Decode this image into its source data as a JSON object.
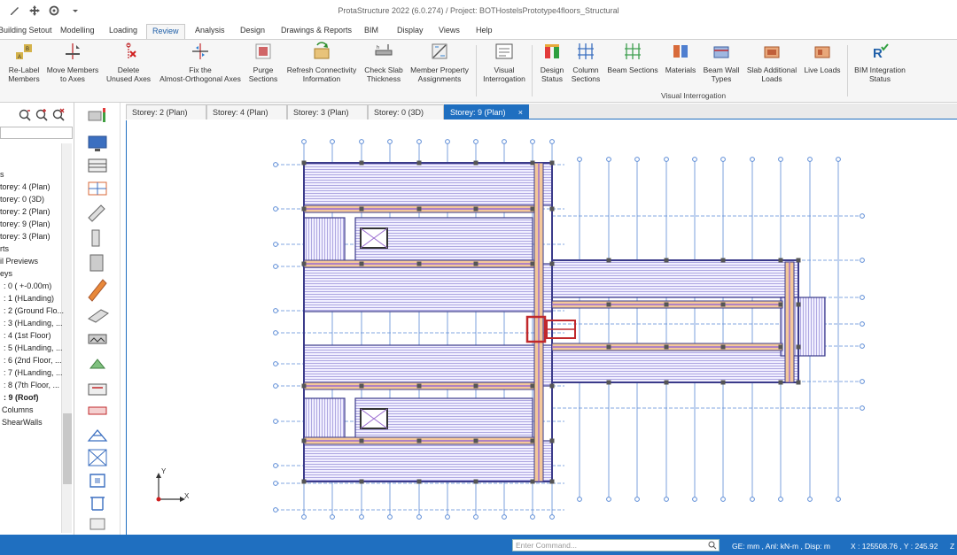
{
  "window": {
    "title": "ProtaStructure 2022 (6.0.274) / Project: BOTHostelsPrototype4floors_Structural"
  },
  "quick_access": [
    "edit-icon",
    "move-icon",
    "settings-icon",
    "dropdown-icon"
  ],
  "menu": {
    "tabs": [
      "Building Setout",
      "Modelling",
      "Loading",
      "Review",
      "Analysis",
      "Design",
      "Drawings & Reports",
      "BIM",
      "Display",
      "Views",
      "Help"
    ],
    "active": "Review"
  },
  "ribbon": {
    "buttons": [
      {
        "l1": "Re-Label",
        "l2": "Members"
      },
      {
        "l1": "Move Members",
        "l2": "to Axes"
      },
      {
        "l1": "Delete",
        "l2": "Unused Axes"
      },
      {
        "l1": "Fix the",
        "l2": "Almost-Orthogonal Axes"
      },
      {
        "l1": "Purge",
        "l2": "Sections"
      },
      {
        "l1": "Refresh Connectivity",
        "l2": "Information"
      },
      {
        "l1": "Check Slab",
        "l2": "Thickness"
      },
      {
        "l1": "Member Property",
        "l2": "Assignments"
      },
      {
        "l1": "Visual",
        "l2": "Interrogation"
      },
      {
        "l1": "Design",
        "l2": "Status"
      },
      {
        "l1": "Column",
        "l2": "Sections"
      },
      {
        "l1": "Beam Sections",
        "l2": ""
      },
      {
        "l1": "Materials",
        "l2": ""
      },
      {
        "l1": "Beam Wall",
        "l2": "Types"
      },
      {
        "l1": "Slab Additional",
        "l2": "Loads"
      },
      {
        "l1": "Live Loads",
        "l2": ""
      },
      {
        "l1": "BIM Integration",
        "l2": "Status"
      }
    ],
    "group_label": "Visual Interrogation"
  },
  "tree": {
    "items": [
      {
        "text": "s",
        "bold": false
      },
      {
        "text": "torey: 4 (Plan)",
        "bold": false
      },
      {
        "text": "torey: 0 (3D)",
        "bold": false
      },
      {
        "text": "torey: 2 (Plan)",
        "bold": false
      },
      {
        "text": "torey: 9 (Plan)",
        "bold": false
      },
      {
        "text": "torey: 3 (Plan)",
        "bold": false
      },
      {
        "text": "rts",
        "bold": false
      },
      {
        "text": "il Previews",
        "bold": false
      },
      {
        "text": "eys",
        "bold": false
      },
      {
        "text": ": 0 ( +-0.00m)",
        "bold": false
      },
      {
        "text": ": 1 (HLanding)",
        "bold": false
      },
      {
        "text": ": 2 (Ground Flo...",
        "bold": false
      },
      {
        "text": ": 3 (HLanding, ...",
        "bold": false
      },
      {
        "text": ": 4 (1st Floor)",
        "bold": false
      },
      {
        "text": ": 5 (HLanding, ...",
        "bold": false
      },
      {
        "text": ": 6 (2nd Floor, ...",
        "bold": false
      },
      {
        "text": ": 7 (HLanding, ...",
        "bold": false
      },
      {
        "text": ": 8 (7th Floor, ...",
        "bold": false
      },
      {
        "text": ": 9 (Roof)",
        "bold": true
      },
      {
        "text": "Columns",
        "bold": false
      },
      {
        "text": "ShearWalls",
        "bold": false
      }
    ]
  },
  "doc_tabs": [
    {
      "label": "Storey: 2 (Plan)",
      "active": false
    },
    {
      "label": "Storey: 4 (Plan)",
      "active": false
    },
    {
      "label": "Storey: 3 (Plan)",
      "active": false
    },
    {
      "label": "Storey: 0 (3D)",
      "active": false
    },
    {
      "label": "Storey: 9 (Plan)",
      "active": true
    }
  ],
  "doc_tab_close": "×",
  "canvas": {
    "axis_y": "Y",
    "axis_x": "X"
  },
  "statusbar": {
    "command_placeholder": "Enter Command...",
    "units": "GE: mm , Anl: kN-m , Disp: m",
    "coords": "X : 125508.76 , Y : 245.92",
    "extra": "Z"
  },
  "colors": {
    "accent": "#1f6fc0",
    "slab_hatch": "#8f86d6",
    "beam_edge": "#3b3b8a",
    "beam_fill": "#f4c89a",
    "column_red": "#c0282b",
    "axis_line": "#5b8bd6"
  }
}
